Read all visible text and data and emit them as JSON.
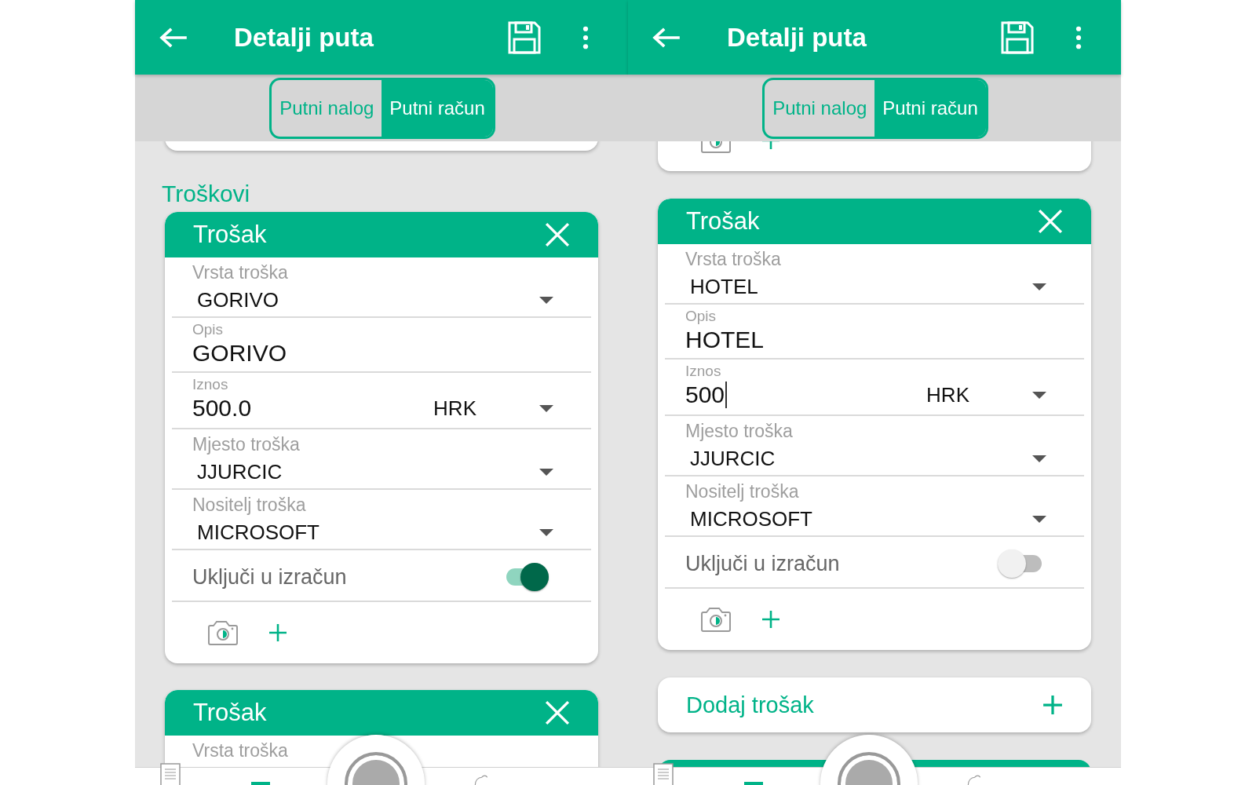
{
  "screens": [
    {
      "title": "Detalji puta",
      "tabs": [
        {
          "label": "Putni nalog",
          "selected": false
        },
        {
          "label": "Putni račun",
          "selected": true
        }
      ],
      "items": [
        {
          "kind": "stub"
        },
        {
          "kind": "heading",
          "text": "Troškovi"
        },
        {
          "kind": "expense",
          "title": "Trošak",
          "fields": [
            {
              "kind": "dropdown",
              "label": "Vrsta troška",
              "value": "GORIVO"
            },
            {
              "kind": "text",
              "label": "Opis",
              "value": "GORIVO"
            },
            {
              "kind": "amount",
              "label": "Iznos",
              "value": "500.0",
              "currency": "HRK",
              "focused": false
            },
            {
              "kind": "dropdown",
              "label": "Mjesto troška",
              "value": "JJURCIC"
            },
            {
              "kind": "dropdown",
              "label": "Nositelj troška",
              "value": "MICROSOFT"
            }
          ],
          "include": {
            "label": "Uključi u izračun",
            "on": true
          },
          "attachments": true
        },
        {
          "kind": "expense",
          "title": "Trošak",
          "fields": [
            {
              "kind": "dropdown",
              "label": "Vrsta troška"
            }
          ],
          "attachments": false
        }
      ]
    },
    {
      "title": "Detalji puta",
      "tabs": [
        {
          "label": "Putni nalog",
          "selected": false
        },
        {
          "label": "Putni račun",
          "selected": true
        }
      ],
      "items": [
        {
          "kind": "attachments-stub"
        },
        {
          "kind": "expense",
          "title": "Trošak",
          "fields": [
            {
              "kind": "dropdown",
              "label": "Vrsta troška",
              "value": "HOTEL"
            },
            {
              "kind": "text",
              "label": "Opis",
              "value": "HOTEL"
            },
            {
              "kind": "amount",
              "label": "Iznos",
              "value": "500",
              "currency": "HRK",
              "focused": true
            },
            {
              "kind": "dropdown",
              "label": "Mjesto troška",
              "value": "JJURCIC"
            },
            {
              "kind": "dropdown",
              "label": "Nositelj troška",
              "value": "MICROSOFT"
            }
          ],
          "include": {
            "label": "Uključi u izračun",
            "on": false
          },
          "attachments": true
        },
        {
          "kind": "add",
          "label": "Dodaj trošak"
        },
        {
          "kind": "header-stub"
        }
      ]
    }
  ]
}
